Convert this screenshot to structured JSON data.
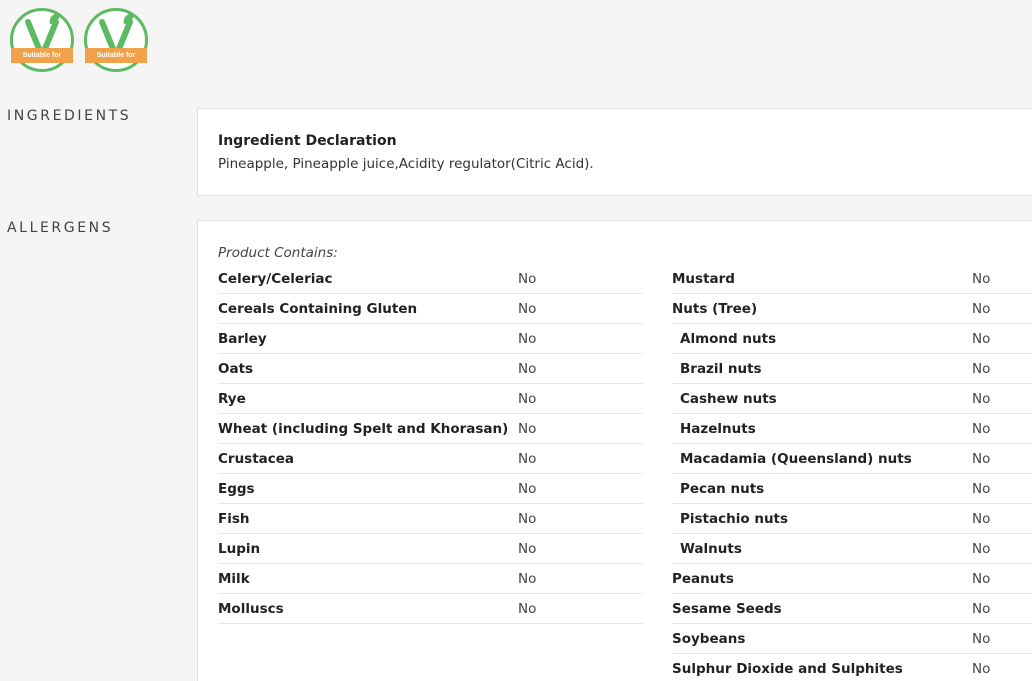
{
  "badges": [
    {
      "ribbon": "Suitable for",
      "icon": "vegan-v-leaf-icon",
      "color_ring": "#5cbb62",
      "color_ribbon": "#f0a24a"
    },
    {
      "ribbon": "Suitable for",
      "icon": "vegetarian-v-leaf-icon",
      "color_ring": "#5cbb62",
      "color_ribbon": "#f0a24a"
    }
  ],
  "ingredients": {
    "section_label": "INGREDIENTS",
    "title": "Ingredient Declaration",
    "text": "Pineapple, Pineapple juice,Acidity regulator(Citric Acid)."
  },
  "allergens": {
    "section_label": "ALLERGENS",
    "contains_label": "Product Contains:",
    "left": [
      {
        "name": "Celery/Celeriac",
        "value": "No"
      },
      {
        "name": "Cereals Containing Gluten",
        "value": "No"
      },
      {
        "name": "Barley",
        "value": "No"
      },
      {
        "name": "Oats",
        "value": "No"
      },
      {
        "name": "Rye",
        "value": "No"
      },
      {
        "name": "Wheat (including Spelt and Khorasan)",
        "value": "No"
      },
      {
        "name": "Crustacea",
        "value": "No"
      },
      {
        "name": "Eggs",
        "value": "No"
      },
      {
        "name": "Fish",
        "value": "No"
      },
      {
        "name": "Lupin",
        "value": "No"
      },
      {
        "name": "Milk",
        "value": "No"
      },
      {
        "name": "Molluscs",
        "value": "No"
      }
    ],
    "right": [
      {
        "name": "Mustard",
        "value": "No"
      },
      {
        "name": "Nuts (Tree)",
        "value": "No"
      },
      {
        "name": "Almond nuts",
        "value": "No"
      },
      {
        "name": "Brazil nuts",
        "value": "No"
      },
      {
        "name": "Cashew nuts",
        "value": "No"
      },
      {
        "name": "Hazelnuts",
        "value": "No"
      },
      {
        "name": "Macadamia (Queensland) nuts",
        "value": "No"
      },
      {
        "name": "Pecan nuts",
        "value": "No"
      },
      {
        "name": "Pistachio nuts",
        "value": "No"
      },
      {
        "name": "Walnuts",
        "value": "No"
      },
      {
        "name": "Peanuts",
        "value": "No"
      },
      {
        "name": "Sesame Seeds",
        "value": "No"
      },
      {
        "name": "Soybeans",
        "value": "No"
      },
      {
        "name": "Sulphur Dioxide and Sulphites",
        "value": "No"
      }
    ]
  }
}
